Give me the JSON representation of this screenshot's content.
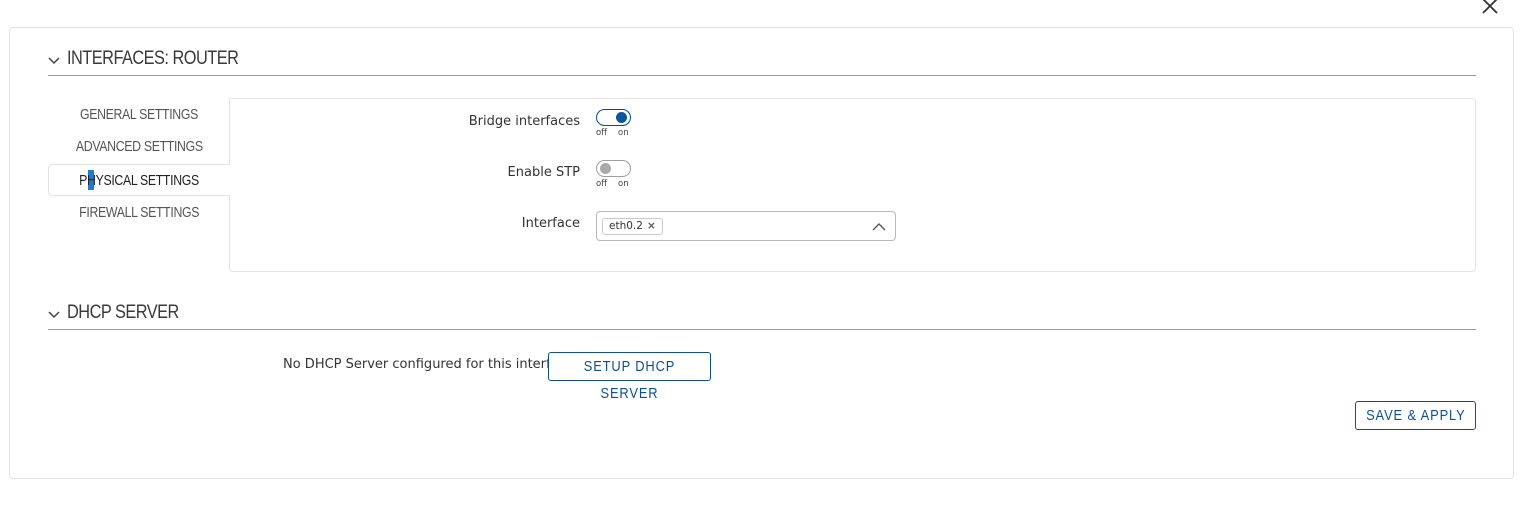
{
  "dialog": {
    "close_icon": "close-icon"
  },
  "interfaces_section": {
    "title": "INTERFACES: ROUTER",
    "tabs": [
      {
        "label": "GENERAL SETTINGS",
        "active": false
      },
      {
        "label": "ADVANCED SETTINGS",
        "active": false
      },
      {
        "label": "PHYSICAL SETTINGS",
        "active": true
      },
      {
        "label": "FIREWALL SETTINGS",
        "active": false
      }
    ],
    "fields": {
      "bridge_interfaces": {
        "label": "Bridge interfaces",
        "value": "on",
        "off_text": "off",
        "on_text": "on"
      },
      "enable_stp": {
        "label": "Enable STP",
        "value": "off",
        "off_text": "off",
        "on_text": "on"
      },
      "interface": {
        "label": "Interface",
        "selected_tags": [
          "eth0.2"
        ],
        "remove_glyph": "×"
      }
    }
  },
  "dhcp_section": {
    "title": "DHCP SERVER",
    "message": "No DHCP Server configured for this interface",
    "setup_button": "SETUP DHCP SERVER"
  },
  "footer": {
    "save_apply_button": "SAVE & APPLY"
  },
  "colors": {
    "accent": "#0d4f94",
    "toggle_on": "#0a56a3",
    "border": "#e3e3e3"
  }
}
